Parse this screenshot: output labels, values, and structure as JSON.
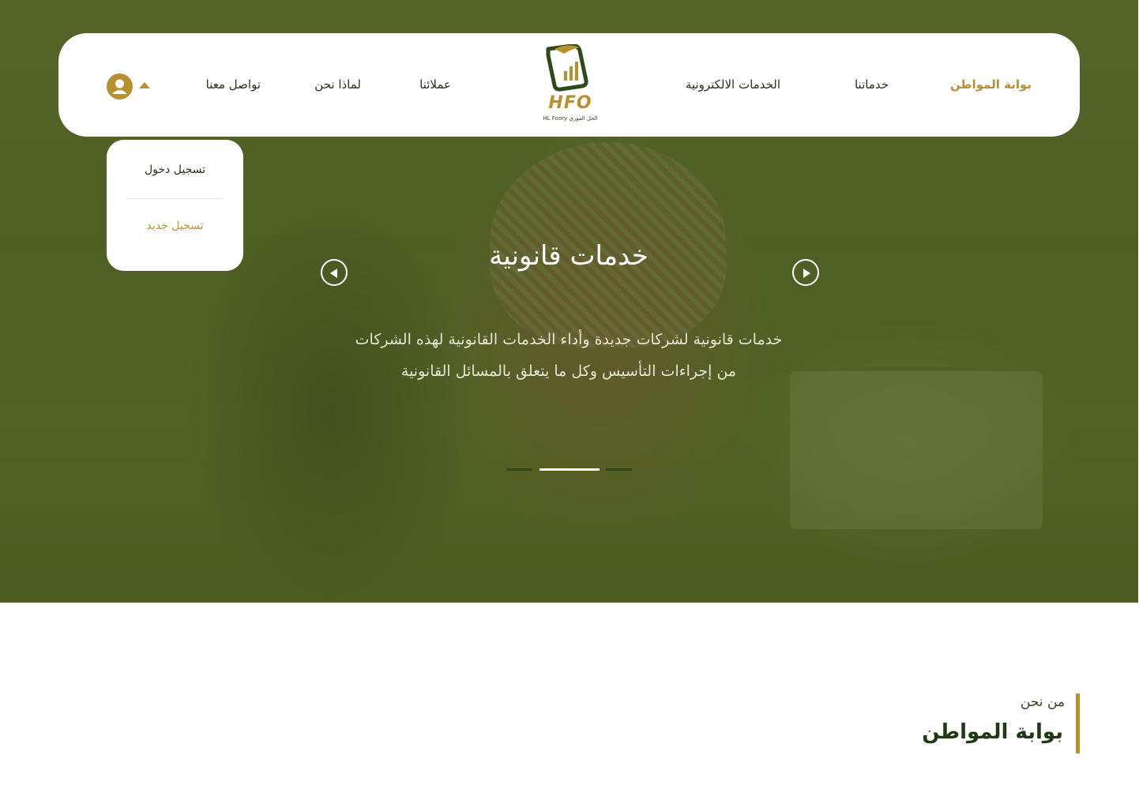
{
  "nav": {
    "items": [
      {
        "label": "بوابة المواطن",
        "active": true
      },
      {
        "label": "خدماتنا"
      },
      {
        "label": "الخدمات الالكترونية"
      },
      {
        "label": "عملائنا"
      },
      {
        "label": "لماذا نحن"
      },
      {
        "label": "تواصل معنا"
      }
    ]
  },
  "logo": {
    "text": "HFO",
    "subtext": "HL Foory الحل الفوري"
  },
  "user_menu": {
    "login": "تسجيل دخول",
    "register": "تسجيل جديد"
  },
  "slide": {
    "title": "خدمات قانونية",
    "line1": "خدمات قانونية لشركات جديدة وأداء الخدمات القانونية لهذه الشركات",
    "line2": "من إجراءات التأسيس وكل ما يتعلق بالمسائل القانونية",
    "active_slide": 2,
    "slide_count": 3
  },
  "section": {
    "subtitle": "من نحن",
    "title": "بوابة المواطن"
  },
  "colors": {
    "accent": "#b8902f",
    "primary": "#2f4a1a",
    "overlay": "#4e6022"
  }
}
